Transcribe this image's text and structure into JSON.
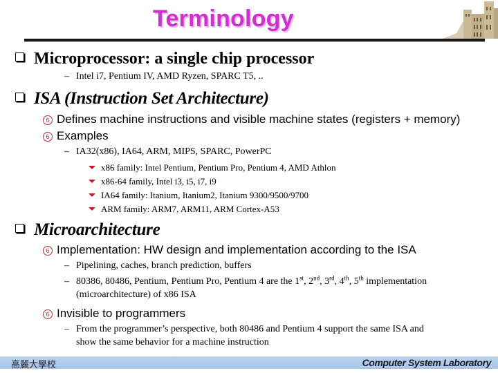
{
  "slide": {
    "title": "Terminology",
    "title_color": "#cc33cc"
  },
  "sections": [
    {
      "heading": "Microprocessor: a single chip processor",
      "sub": [
        {
          "text": "Intel i7, Pentium IV, AMD Ryzen, SPARC T5, .."
        }
      ]
    },
    {
      "heading": "ISA (Instruction Set Architecture)",
      "points": [
        {
          "text": "Defines machine instructions and visible machine states (registers + memory)"
        },
        {
          "text": "Examples"
        }
      ],
      "sub": [
        {
          "text": "IA32(x86), IA64, ARM, MIPS, SPARC, PowerPC"
        }
      ],
      "subsub": [
        {
          "text": "x86 family: Intel Pentium, Pentium Pro, Pentium 4, AMD Athlon"
        },
        {
          "text": "x86-64 family, Intel i3, i5, i7, i9"
        },
        {
          "text": "IA64 family: Itanium, Itanium2, Itanium 9300/9500/9700"
        },
        {
          "text": "ARM family: ARM7, ARM11, ARM Cortex-A53"
        }
      ]
    },
    {
      "heading": "Microarchitecture",
      "points": [
        {
          "text": "Implementation: HW design and implementation according to the ISA"
        },
        {
          "text": "Invisible to programmers"
        }
      ],
      "sub_a": [
        {
          "text": "Pipelining, caches, branch prediction, buffers"
        }
      ],
      "ordinals_line": {
        "prefix": "80386, 80486, Pentium, Pentium Pro, Pentium 4 are the ",
        "o1": "1",
        "s1": "st",
        "o2": "2",
        "s2": "nd",
        "o3": "3",
        "s3": "rd",
        "o4": "4",
        "s4": "th",
        "o5": "5",
        "s5": "th",
        "suffix": " implementation",
        "continuation": "(microarchitecture) of x86 ISA"
      },
      "sub_b": {
        "line1": "From the programmer’s perspective, both 80486 and Pentium 4 support the same ISA and",
        "line2": "show the same behavior for a machine instruction"
      }
    }
  ],
  "icons": {
    "level1": "square-bullet-icon",
    "level2": "circled-six-bullet-icon",
    "level4": "red-down-triangle-icon"
  },
  "footer": {
    "left": "高麗大學校",
    "right": "Computer System Laboratory",
    "bar_color": "#b0cbeb"
  }
}
